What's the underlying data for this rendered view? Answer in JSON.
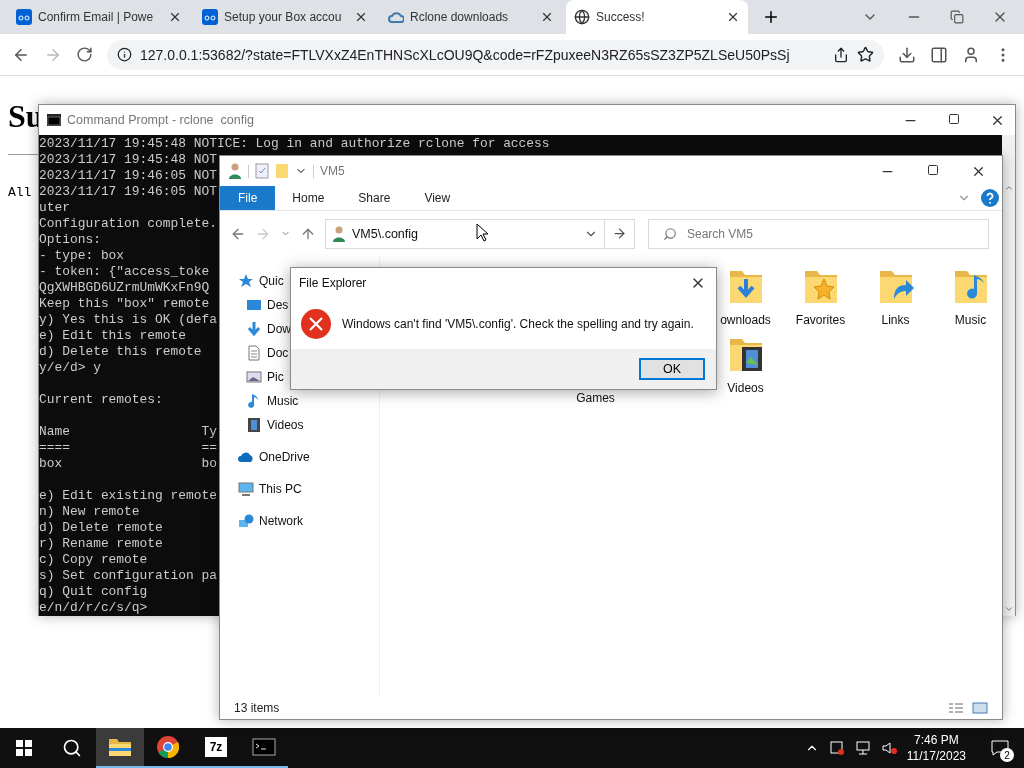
{
  "browser": {
    "tabs": [
      {
        "title": "Confirm Email | Powe",
        "kind": "box",
        "selected": false
      },
      {
        "title": "Setup your Box accou",
        "kind": "box",
        "selected": false
      },
      {
        "title": "Rclone downloads",
        "kind": "cloud",
        "selected": false
      },
      {
        "title": "Success!",
        "kind": "globe",
        "selected": true
      }
    ],
    "url": "127.0.0.1:53682/?state=FTLVXxZ4EnTHNScXLcOU9Q&code=rFZpuxeeN3RZ65sSZ3ZP5ZLSeU50PsSj",
    "page": {
      "heading": "Su",
      "text": "All"
    }
  },
  "command_prompt": {
    "title": "Command Prompt - rclone  config",
    "blocks": [
      [
        "2023/11/17 19:45:48 NOTICE: Log in and authorize rclone for access",
        "2023/11/17 19:45:48 NOT",
        "2023/11/17 19:46:05 NOT",
        "2023/11/17 19:46:05 NOT",
        "uter",
        "Configuration complete.",
        "Options:",
        "- type: box",
        "- token: {\"access_toke",
        "QgXWHBGD6UZrmUmWKxFn9Q",
        "Keep this \"box\" remote",
        "y) Yes this is OK (defa",
        "e) Edit this remote",
        "d) Delete this remote",
        "y/e/d> y"
      ],
      [
        "Current remotes:"
      ],
      [
        "Name                 Ty",
        "====                 ==",
        "box                  bo"
      ],
      [
        "e) Edit existing remote",
        "n) New remote",
        "d) Delete remote",
        "r) Rename remote",
        "c) Copy remote",
        "s) Set configuration pa",
        "q) Quit config",
        "e/n/d/r/c/s/q>"
      ]
    ]
  },
  "explorer": {
    "title": "VM5",
    "ribbon_tabs": [
      {
        "label": "File",
        "selected": true
      },
      {
        "label": "Home",
        "selected": false
      },
      {
        "label": "Share",
        "selected": false
      },
      {
        "label": "View",
        "selected": false
      }
    ],
    "address": "VM5\\.config",
    "search": {
      "placeholder": "Search VM5"
    },
    "nav": [
      {
        "label": "Quic",
        "kind": "star",
        "children": [
          {
            "label": "Des",
            "kind": "desktop"
          },
          {
            "label": "Dow",
            "kind": "download"
          },
          {
            "label": "Doc",
            "kind": "document"
          },
          {
            "label": "Pic",
            "kind": "pictures"
          },
          {
            "label": "Music",
            "kind": "music"
          },
          {
            "label": "Videos",
            "kind": "video"
          }
        ]
      },
      {
        "label": "OneDrive",
        "kind": "cloud"
      },
      {
        "label": "This PC",
        "kind": "pc"
      },
      {
        "label": "Network",
        "kind": "network"
      }
    ],
    "items": [
      [
        {
          "label": "ownloads",
          "kind": "downloads"
        },
        {
          "label": "Favorites",
          "kind": "favorites"
        },
        {
          "label": "Links",
          "kind": "links"
        },
        {
          "label": "Music",
          "kind": "music"
        }
      ],
      [
        {
          "label": "Games",
          "kind": "covered"
        },
        {
          "label": "Videos",
          "kind": "videos"
        }
      ]
    ],
    "status": "13 items"
  },
  "dialog": {
    "title": "File Explorer",
    "message": "Windows can't find 'VM5\\.config'. Check the spelling and try again.",
    "button": "OK"
  },
  "taskbar": {
    "apps": [
      {
        "kind": "explorer",
        "active": true
      },
      {
        "kind": "chrome",
        "active": false
      },
      {
        "kind": "zip",
        "label": "7z",
        "active": false
      },
      {
        "kind": "console",
        "active": false
      }
    ],
    "time": "7:46 PM",
    "date": "11/17/2023",
    "notifications": "2"
  }
}
